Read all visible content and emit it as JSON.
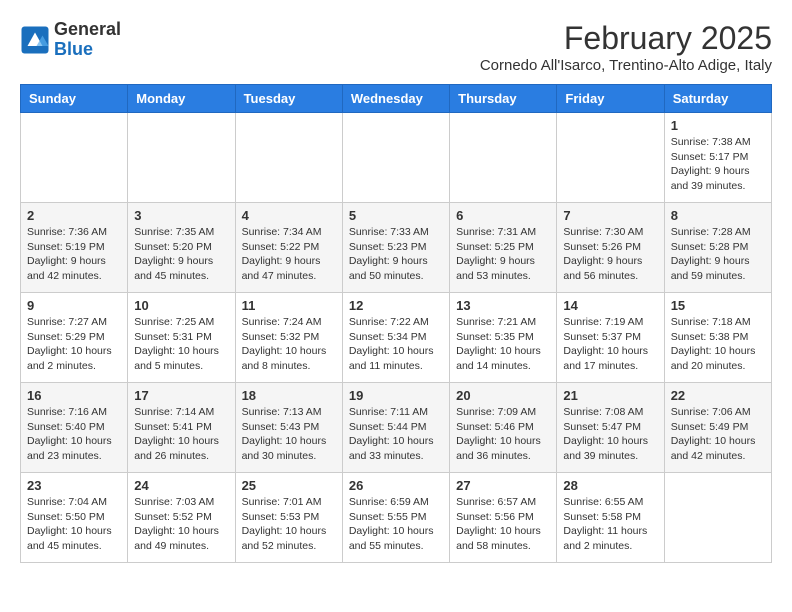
{
  "header": {
    "logo_general": "General",
    "logo_blue": "Blue",
    "month_title": "February 2025",
    "subtitle": "Cornedo All'Isarco, Trentino-Alto Adige, Italy"
  },
  "days_of_week": [
    "Sunday",
    "Monday",
    "Tuesday",
    "Wednesday",
    "Thursday",
    "Friday",
    "Saturday"
  ],
  "weeks": [
    [
      {
        "day": "",
        "info": ""
      },
      {
        "day": "",
        "info": ""
      },
      {
        "day": "",
        "info": ""
      },
      {
        "day": "",
        "info": ""
      },
      {
        "day": "",
        "info": ""
      },
      {
        "day": "",
        "info": ""
      },
      {
        "day": "1",
        "info": "Sunrise: 7:38 AM\nSunset: 5:17 PM\nDaylight: 9 hours and 39 minutes."
      }
    ],
    [
      {
        "day": "2",
        "info": "Sunrise: 7:36 AM\nSunset: 5:19 PM\nDaylight: 9 hours and 42 minutes."
      },
      {
        "day": "3",
        "info": "Sunrise: 7:35 AM\nSunset: 5:20 PM\nDaylight: 9 hours and 45 minutes."
      },
      {
        "day": "4",
        "info": "Sunrise: 7:34 AM\nSunset: 5:22 PM\nDaylight: 9 hours and 47 minutes."
      },
      {
        "day": "5",
        "info": "Sunrise: 7:33 AM\nSunset: 5:23 PM\nDaylight: 9 hours and 50 minutes."
      },
      {
        "day": "6",
        "info": "Sunrise: 7:31 AM\nSunset: 5:25 PM\nDaylight: 9 hours and 53 minutes."
      },
      {
        "day": "7",
        "info": "Sunrise: 7:30 AM\nSunset: 5:26 PM\nDaylight: 9 hours and 56 minutes."
      },
      {
        "day": "8",
        "info": "Sunrise: 7:28 AM\nSunset: 5:28 PM\nDaylight: 9 hours and 59 minutes."
      }
    ],
    [
      {
        "day": "9",
        "info": "Sunrise: 7:27 AM\nSunset: 5:29 PM\nDaylight: 10 hours and 2 minutes."
      },
      {
        "day": "10",
        "info": "Sunrise: 7:25 AM\nSunset: 5:31 PM\nDaylight: 10 hours and 5 minutes."
      },
      {
        "day": "11",
        "info": "Sunrise: 7:24 AM\nSunset: 5:32 PM\nDaylight: 10 hours and 8 minutes."
      },
      {
        "day": "12",
        "info": "Sunrise: 7:22 AM\nSunset: 5:34 PM\nDaylight: 10 hours and 11 minutes."
      },
      {
        "day": "13",
        "info": "Sunrise: 7:21 AM\nSunset: 5:35 PM\nDaylight: 10 hours and 14 minutes."
      },
      {
        "day": "14",
        "info": "Sunrise: 7:19 AM\nSunset: 5:37 PM\nDaylight: 10 hours and 17 minutes."
      },
      {
        "day": "15",
        "info": "Sunrise: 7:18 AM\nSunset: 5:38 PM\nDaylight: 10 hours and 20 minutes."
      }
    ],
    [
      {
        "day": "16",
        "info": "Sunrise: 7:16 AM\nSunset: 5:40 PM\nDaylight: 10 hours and 23 minutes."
      },
      {
        "day": "17",
        "info": "Sunrise: 7:14 AM\nSunset: 5:41 PM\nDaylight: 10 hours and 26 minutes."
      },
      {
        "day": "18",
        "info": "Sunrise: 7:13 AM\nSunset: 5:43 PM\nDaylight: 10 hours and 30 minutes."
      },
      {
        "day": "19",
        "info": "Sunrise: 7:11 AM\nSunset: 5:44 PM\nDaylight: 10 hours and 33 minutes."
      },
      {
        "day": "20",
        "info": "Sunrise: 7:09 AM\nSunset: 5:46 PM\nDaylight: 10 hours and 36 minutes."
      },
      {
        "day": "21",
        "info": "Sunrise: 7:08 AM\nSunset: 5:47 PM\nDaylight: 10 hours and 39 minutes."
      },
      {
        "day": "22",
        "info": "Sunrise: 7:06 AM\nSunset: 5:49 PM\nDaylight: 10 hours and 42 minutes."
      }
    ],
    [
      {
        "day": "23",
        "info": "Sunrise: 7:04 AM\nSunset: 5:50 PM\nDaylight: 10 hours and 45 minutes."
      },
      {
        "day": "24",
        "info": "Sunrise: 7:03 AM\nSunset: 5:52 PM\nDaylight: 10 hours and 49 minutes."
      },
      {
        "day": "25",
        "info": "Sunrise: 7:01 AM\nSunset: 5:53 PM\nDaylight: 10 hours and 52 minutes."
      },
      {
        "day": "26",
        "info": "Sunrise: 6:59 AM\nSunset: 5:55 PM\nDaylight: 10 hours and 55 minutes."
      },
      {
        "day": "27",
        "info": "Sunrise: 6:57 AM\nSunset: 5:56 PM\nDaylight: 10 hours and 58 minutes."
      },
      {
        "day": "28",
        "info": "Sunrise: 6:55 AM\nSunset: 5:58 PM\nDaylight: 11 hours and 2 minutes."
      },
      {
        "day": "",
        "info": ""
      }
    ]
  ]
}
